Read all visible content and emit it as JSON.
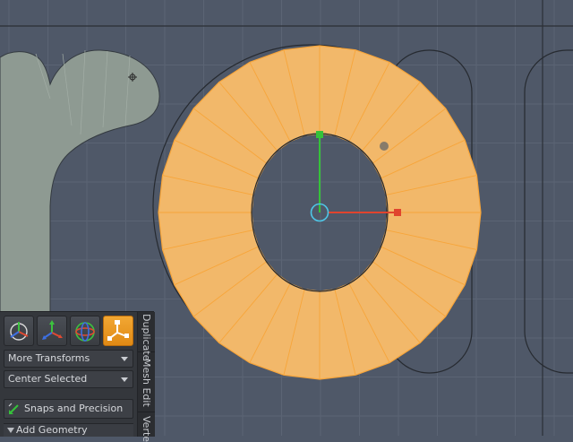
{
  "viewport": {
    "background": "#4f5868",
    "grid_color": "#5b6474",
    "mesh_fill": "#f2b86a",
    "mesh_edge": "#f7a53a",
    "background_mesh_fill": "#8e9a92",
    "x_axis_color": "#e0442e",
    "y_axis_color": "#35c23a",
    "pivot_color": "#4ec7e8"
  },
  "panel": {
    "tool_icons": [
      {
        "name": "transform-icon",
        "active": false
      },
      {
        "name": "move-icon",
        "active": false
      },
      {
        "name": "rotate-icon",
        "active": false
      },
      {
        "name": "scale-icon",
        "active": true
      }
    ],
    "transforms_dropdown": "More Transforms",
    "center_dropdown": "Center Selected",
    "snaps_label": "Snaps and Precision",
    "add_geometry_label": "Add Geometry",
    "side_tabs": [
      "Duplicate",
      "Mesh Edit",
      "Verte"
    ]
  }
}
